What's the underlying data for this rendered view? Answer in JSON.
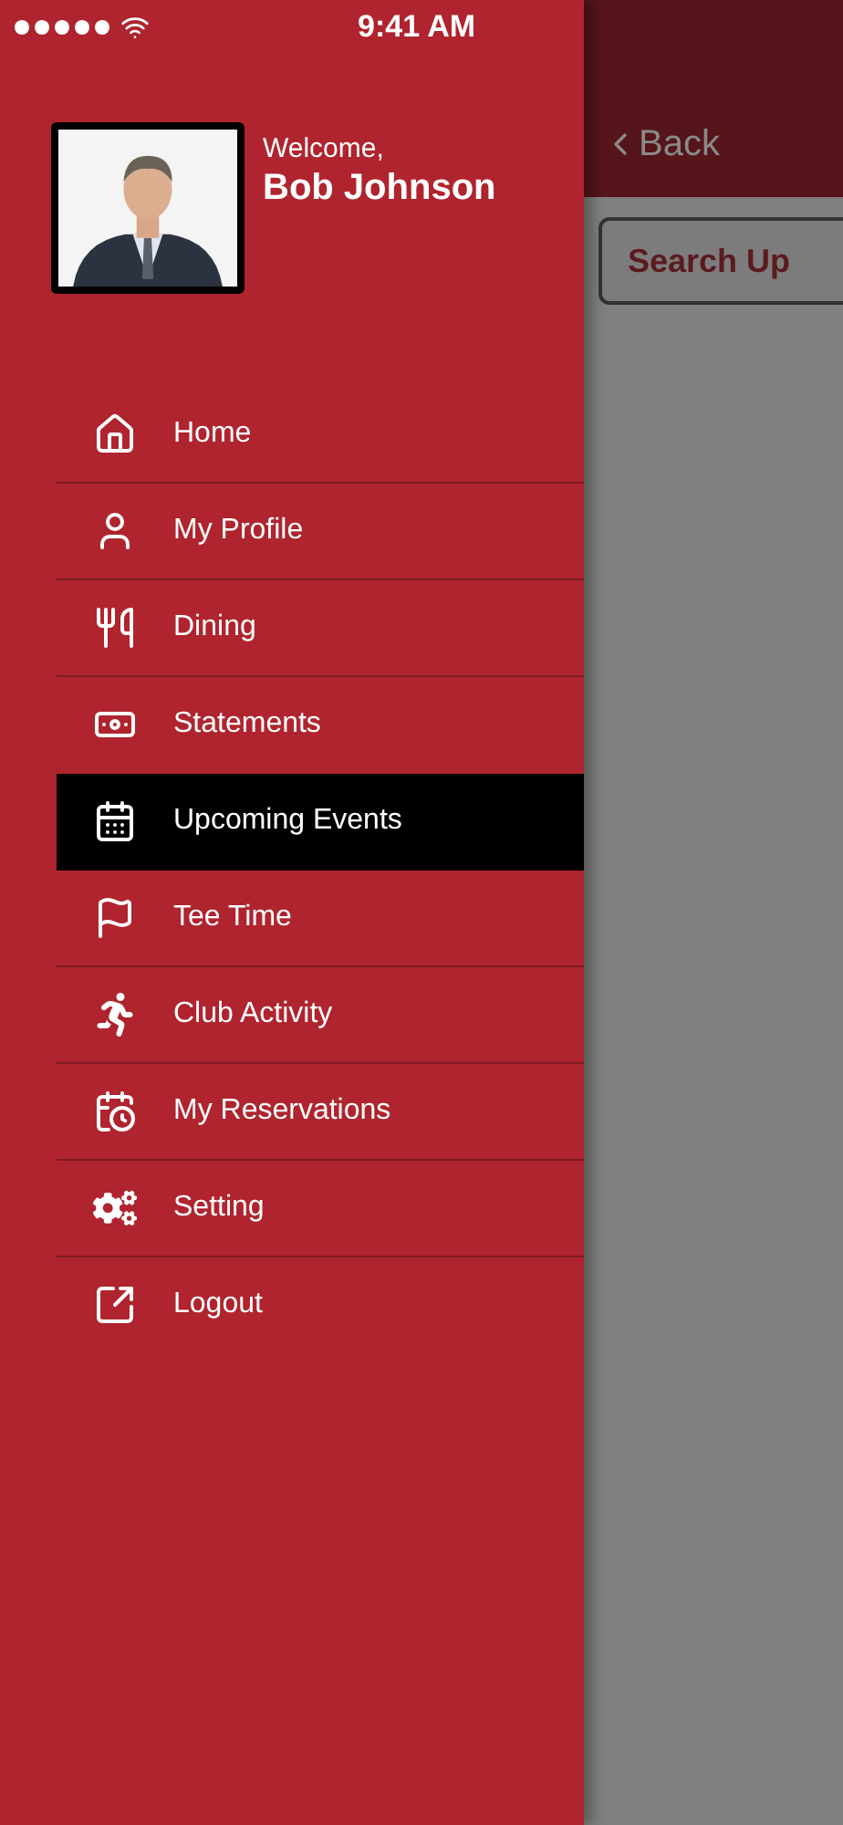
{
  "status_bar": {
    "time": "9:41 AM"
  },
  "profile": {
    "greeting": "Welcome,",
    "name": "Bob Johnson"
  },
  "menu": [
    {
      "label": "Home",
      "selected": false
    },
    {
      "label": "My Profile",
      "selected": false
    },
    {
      "label": "Dining",
      "selected": false
    },
    {
      "label": "Statements",
      "selected": false
    },
    {
      "label": "Upcoming Events",
      "selected": true
    },
    {
      "label": "Tee Time",
      "selected": false
    },
    {
      "label": "Club Activity",
      "selected": false
    },
    {
      "label": "My Reservations",
      "selected": false
    },
    {
      "label": "Setting",
      "selected": false
    },
    {
      "label": "Logout",
      "selected": false
    }
  ],
  "background_screen": {
    "back": "Back",
    "search_button": "Search Up"
  }
}
